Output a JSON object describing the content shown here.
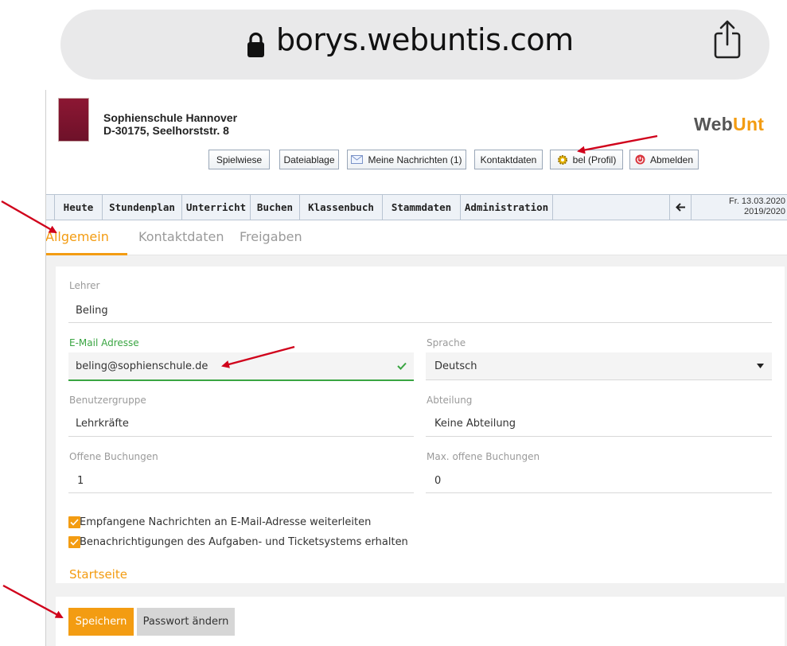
{
  "browser": {
    "url": "borys.webuntis.com",
    "lock_icon": "lock-icon",
    "share_icon": "share-icon"
  },
  "header": {
    "school_name": "Sophienschule Hannover",
    "school_address": "D-30175, Seelhorststr. 8",
    "brand_part1": "Web",
    "brand_part2": "Unt",
    "buttons": {
      "spielwiese": "Spielwiese",
      "dateiablage": "Dateiablage",
      "nachrichten": "Meine Nachrichten (1)",
      "kontaktdaten": "Kontaktdaten",
      "profil": "bel (Profil)",
      "abmelden": "Abmelden"
    }
  },
  "nav": {
    "items": [
      "Heute",
      "Stundenplan",
      "Unterricht",
      "Buchen",
      "Klassenbuch",
      "Stammdaten",
      "Administration"
    ],
    "date": "Fr. 13.03.2020",
    "school_year": "2019/2020"
  },
  "tabs": {
    "allgemein": "Allgemein",
    "kontaktdaten": "Kontaktdaten",
    "freigaben": "Freigaben"
  },
  "form": {
    "lehrer_label": "Lehrer",
    "lehrer_value": "Beling",
    "email_label": "E-Mail Adresse",
    "email_value": "beling@sophienschule.de",
    "sprache_label": "Sprache",
    "sprache_value": "Deutsch",
    "benutzergruppe_label": "Benutzergruppe",
    "benutzergruppe_value": "Lehrkräfte",
    "abteilung_label": "Abteilung",
    "abteilung_value": "Keine Abteilung",
    "offene_label": "Offene Buchungen",
    "offene_value": "1",
    "max_offene_label": "Max. offene Buchungen",
    "max_offene_value": "0",
    "checkbox_forward": "Empfangene Nachrichten an E-Mail-Adresse weiterleiten",
    "checkbox_tickets": "Benachrichtigungen des Aufgaben- und Ticketsystems erhalten",
    "checkbox_forward_checked": true,
    "checkbox_tickets_checked": true,
    "startseite_heading": "Startseite"
  },
  "footer": {
    "save_label": "Speichern",
    "password_label": "Passwort ändern"
  },
  "colors": {
    "accent": "#f39c12",
    "valid": "#3aa542",
    "annotation_arrow": "#d0021b"
  }
}
